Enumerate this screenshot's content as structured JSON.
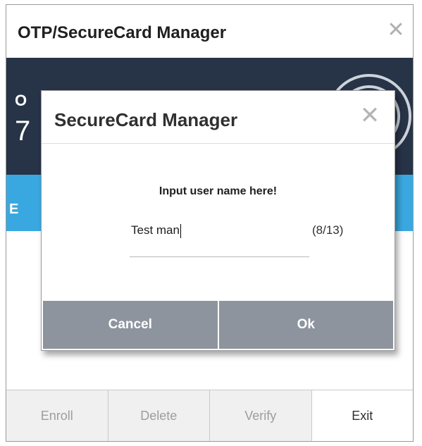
{
  "window": {
    "title": "OTP/SecureCard Manager",
    "close_glyph": "✕",
    "partial_texts": [
      "O",
      "7",
      "E"
    ]
  },
  "bottom_bar": {
    "buttons": [
      {
        "label": "Enroll",
        "enabled": false
      },
      {
        "label": "Delete",
        "enabled": false
      },
      {
        "label": "Verify",
        "enabled": false
      },
      {
        "label": "Exit",
        "enabled": true
      }
    ]
  },
  "dialog": {
    "title": "SecureCard Manager",
    "close_glyph": "✕",
    "prompt": "Input user name here!",
    "input_value": "Test man",
    "counter": "(8/13)",
    "cancel_label": "Cancel",
    "ok_label": "Ok"
  },
  "colors": {
    "dark_band": "#273347",
    "blue_band": "#3aa8e0",
    "dialog_buttons": "#8e949e"
  },
  "icons": [
    "close-icon",
    "logo-ring-icon"
  ]
}
